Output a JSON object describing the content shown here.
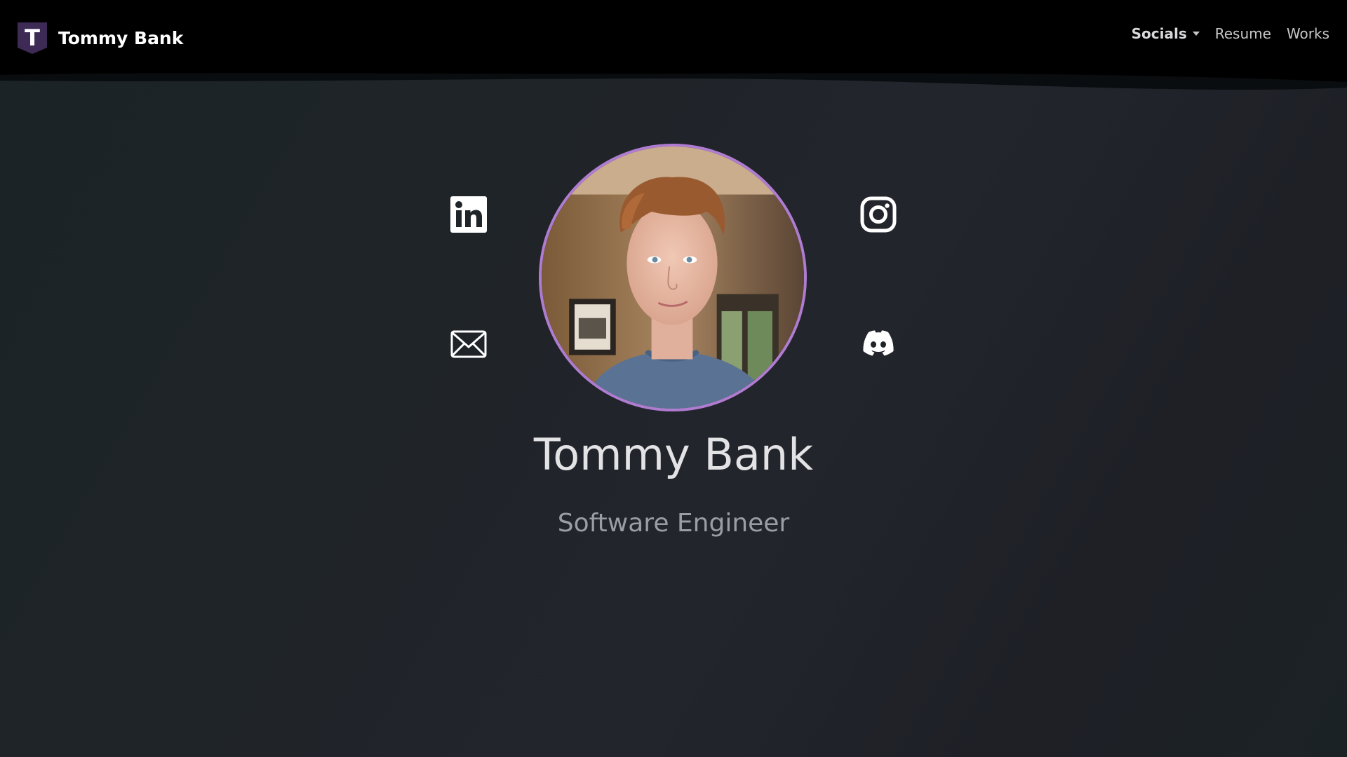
{
  "brand": {
    "logo_letter": "T",
    "name": "Tommy Bank"
  },
  "nav": {
    "socials_label": "Socials",
    "resume_label": "Resume",
    "works_label": "Works"
  },
  "socials": {
    "linkedin_icon": "linkedin-icon",
    "instagram_icon": "instagram-icon",
    "email_icon": "envelope-icon",
    "discord_icon": "discord-icon"
  },
  "profile": {
    "name": "Tommy Bank",
    "role": "Software Engineer"
  },
  "colors": {
    "accent": "#b07cd1",
    "logo_bg": "#3d2a55",
    "navbar": "#000000",
    "background": "#1f2428"
  }
}
